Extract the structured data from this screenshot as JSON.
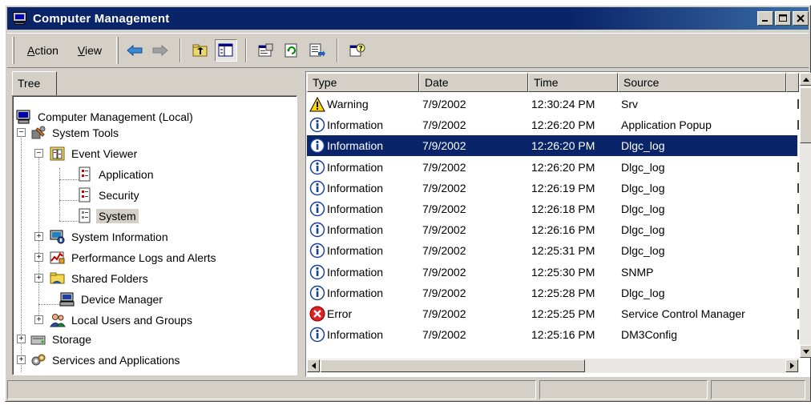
{
  "window": {
    "title": "Computer Management"
  },
  "menu": {
    "action": "Action",
    "action_key": "A",
    "action_rest": "ction",
    "view_key": "V",
    "view_rest": "iew"
  },
  "tree": {
    "tab_label": "Tree",
    "nodes": [
      {
        "label": "Computer Management (Local)",
        "icon": "computer-icon"
      },
      {
        "label": "System Tools",
        "icon": "tools-icon"
      },
      {
        "label": "Event Viewer",
        "icon": "event-viewer-icon"
      },
      {
        "label": "Application",
        "icon": "log-icon"
      },
      {
        "label": "Security",
        "icon": "log-icon"
      },
      {
        "label": "System",
        "icon": "log-icon"
      },
      {
        "label": "System Information",
        "icon": "system-info-icon"
      },
      {
        "label": "Performance Logs and Alerts",
        "icon": "performance-icon"
      },
      {
        "label": "Shared Folders",
        "icon": "folder-icon"
      },
      {
        "label": "Device Manager",
        "icon": "device-manager-icon"
      },
      {
        "label": "Local Users and Groups",
        "icon": "users-icon"
      },
      {
        "label": "Storage",
        "icon": "storage-icon"
      },
      {
        "label": "Services and Applications",
        "icon": "services-icon"
      }
    ]
  },
  "list": {
    "columns": [
      "Type",
      "Date",
      "Time",
      "Source"
    ],
    "rows": [
      {
        "type": "Warning",
        "date": "7/9/2002",
        "time": "12:30:24 PM",
        "source": "Srv",
        "icon": "warning-icon"
      },
      {
        "type": "Information",
        "date": "7/9/2002",
        "time": "12:26:20 PM",
        "source": "Application Popup",
        "icon": "information-icon"
      },
      {
        "type": "Information",
        "date": "7/9/2002",
        "time": "12:26:20 PM",
        "source": "Dlgc_log",
        "icon": "information-icon"
      },
      {
        "type": "Information",
        "date": "7/9/2002",
        "time": "12:26:20 PM",
        "source": "Dlgc_log",
        "icon": "information-icon"
      },
      {
        "type": "Information",
        "date": "7/9/2002",
        "time": "12:26:19 PM",
        "source": "Dlgc_log",
        "icon": "information-icon"
      },
      {
        "type": "Information",
        "date": "7/9/2002",
        "time": "12:26:18 PM",
        "source": "Dlgc_log",
        "icon": "information-icon"
      },
      {
        "type": "Information",
        "date": "7/9/2002",
        "time": "12:26:16 PM",
        "source": "Dlgc_log",
        "icon": "information-icon"
      },
      {
        "type": "Information",
        "date": "7/9/2002",
        "time": "12:25:31 PM",
        "source": "Dlgc_log",
        "icon": "information-icon"
      },
      {
        "type": "Information",
        "date": "7/9/2002",
        "time": "12:25:30 PM",
        "source": "SNMP",
        "icon": "information-icon"
      },
      {
        "type": "Information",
        "date": "7/9/2002",
        "time": "12:25:28 PM",
        "source": "Dlgc_log",
        "icon": "information-icon"
      },
      {
        "type": "Error",
        "date": "7/9/2002",
        "time": "12:25:25 PM",
        "source": "Service Control Manager",
        "icon": "error-icon"
      },
      {
        "type": "Information",
        "date": "7/9/2002",
        "time": "12:25:16 PM",
        "source": "DM3Config",
        "icon": "information-icon"
      }
    ]
  },
  "colors": {
    "title_bar": "#0a246a",
    "selection": "#0a246a",
    "face": "#d4d0c8"
  }
}
